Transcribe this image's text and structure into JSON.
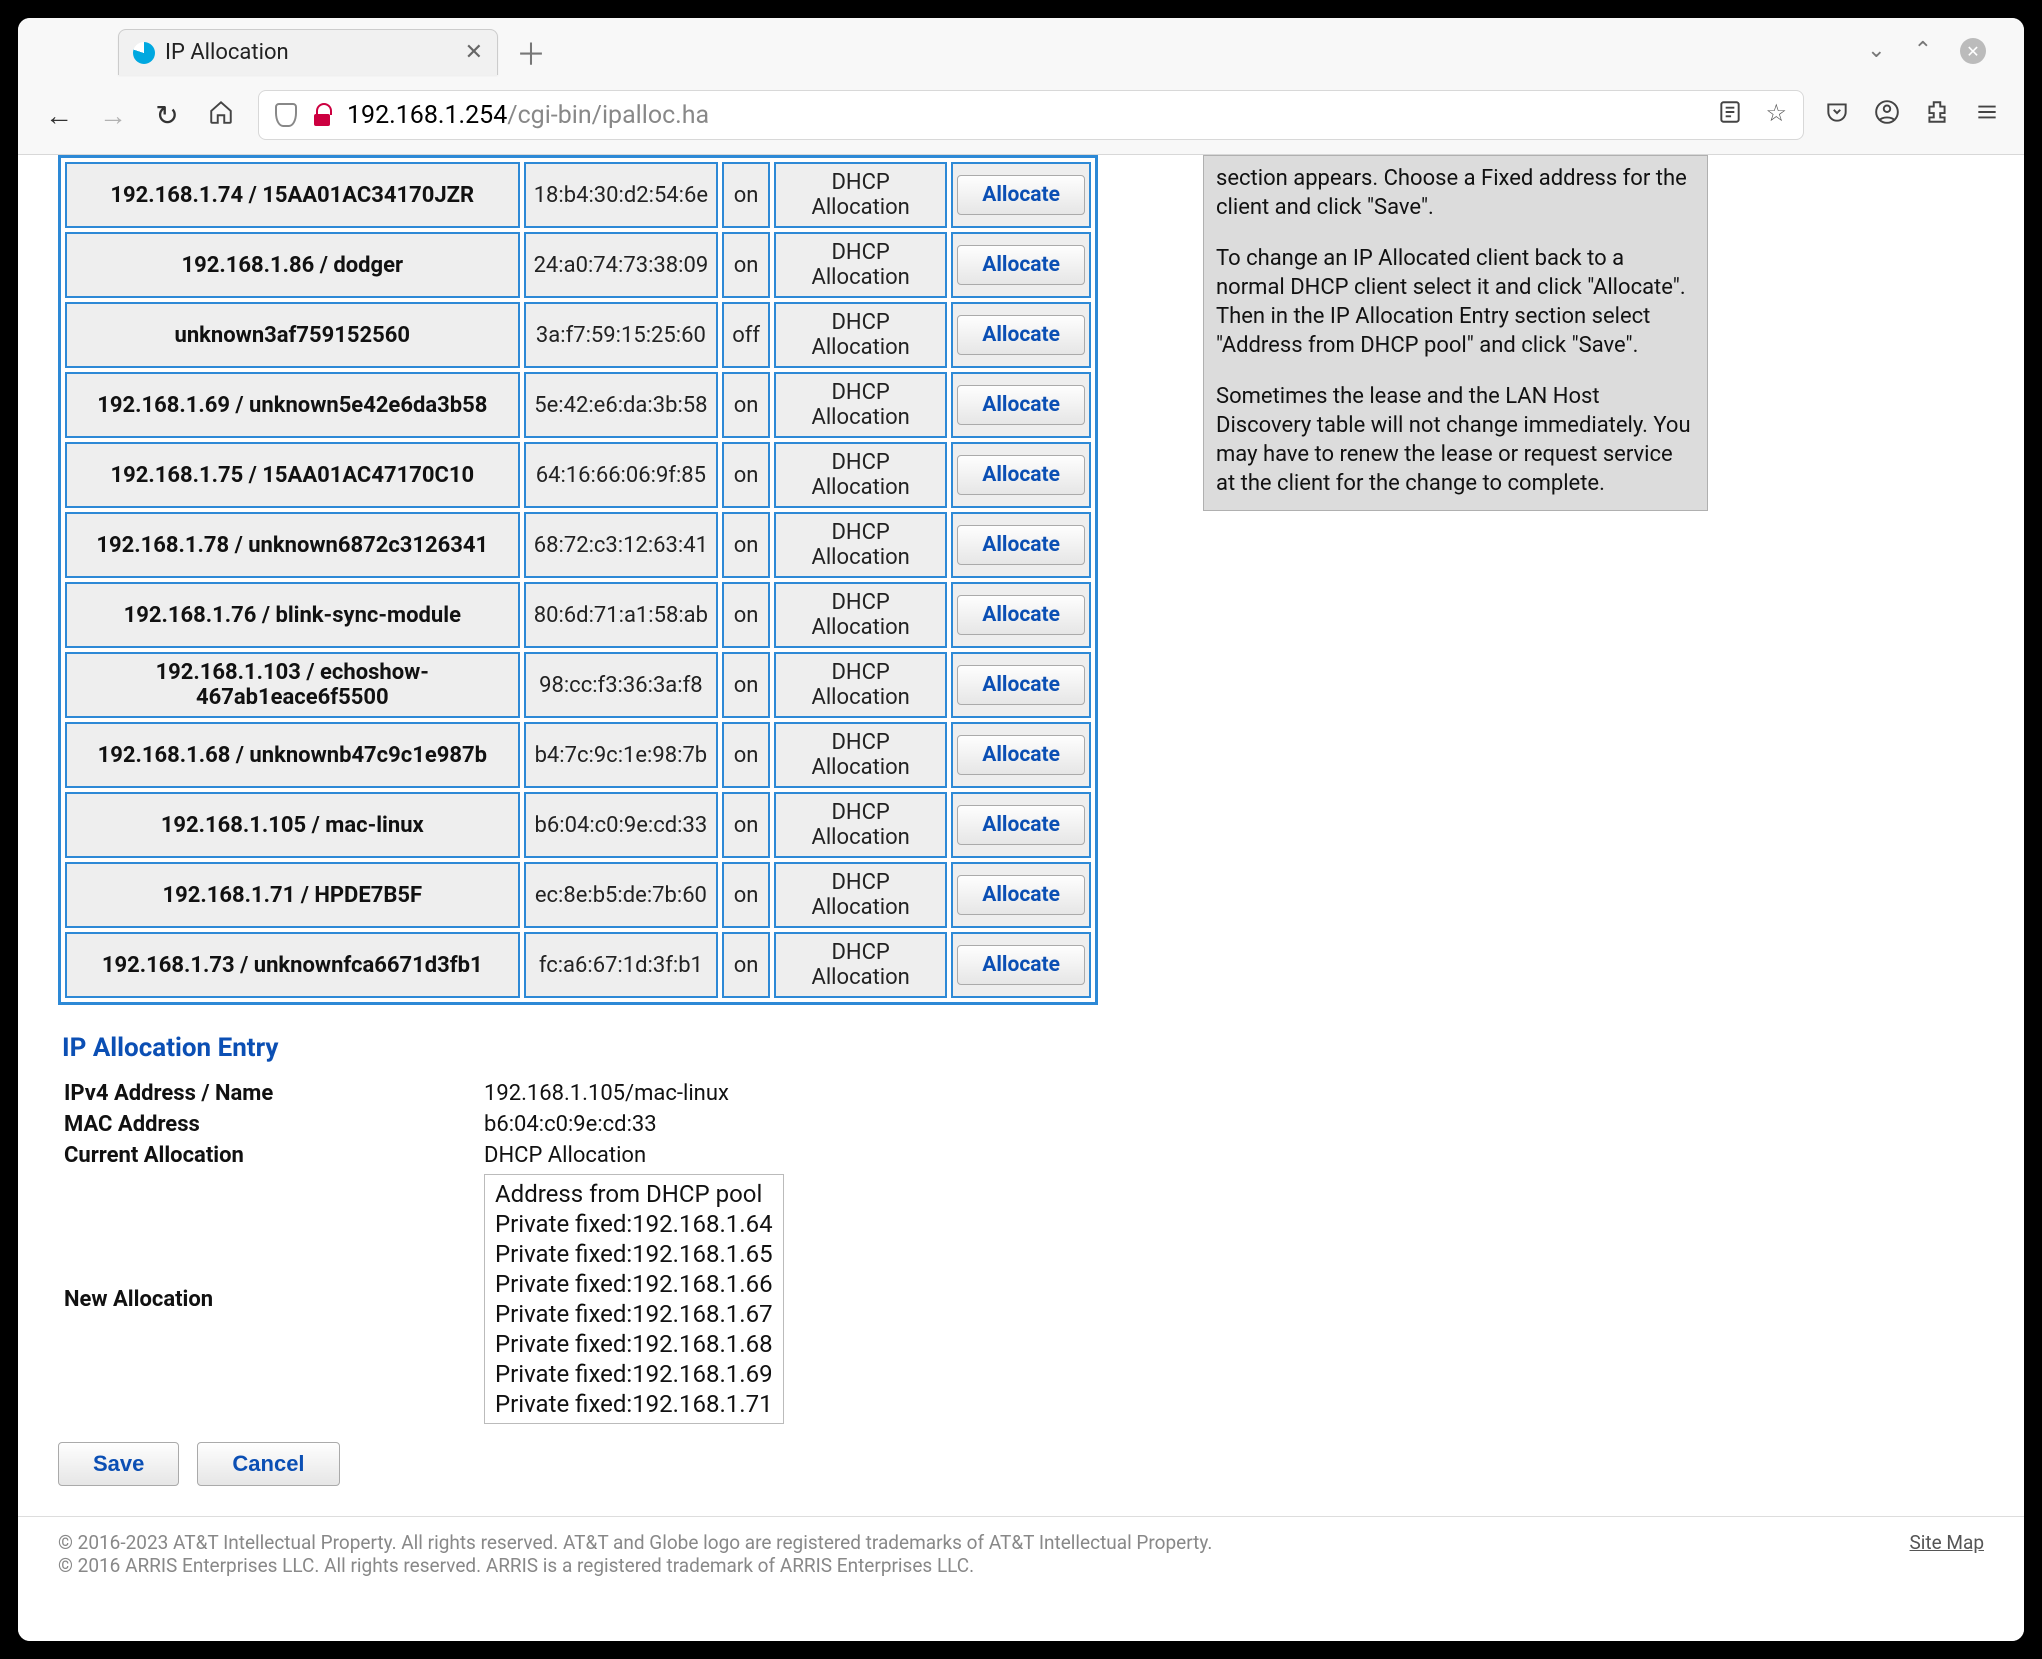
{
  "browser": {
    "tab_title": "IP Allocation",
    "url_host": "192.168.1.254",
    "url_path": "/cgi-bin/ipalloc.ha"
  },
  "table_rows": [
    {
      "name": "192.168.1.74 / 15AA01AC34170JZR",
      "mac": "18:b4:30:d2:54:6e",
      "on": "on",
      "type": "DHCP Allocation",
      "btn": "Allocate"
    },
    {
      "name": "192.168.1.86 / dodger",
      "mac": "24:a0:74:73:38:09",
      "on": "on",
      "type": "DHCP Allocation",
      "btn": "Allocate"
    },
    {
      "name": "unknown3af759152560",
      "mac": "3a:f7:59:15:25:60",
      "on": "off",
      "type": "DHCP Allocation",
      "btn": "Allocate"
    },
    {
      "name": "192.168.1.69 / unknown5e42e6da3b58",
      "mac": "5e:42:e6:da:3b:58",
      "on": "on",
      "type": "DHCP Allocation",
      "btn": "Allocate"
    },
    {
      "name": "192.168.1.75 / 15AA01AC47170C10",
      "mac": "64:16:66:06:9f:85",
      "on": "on",
      "type": "DHCP Allocation",
      "btn": "Allocate"
    },
    {
      "name": "192.168.1.78 / unknown6872c3126341",
      "mac": "68:72:c3:12:63:41",
      "on": "on",
      "type": "DHCP Allocation",
      "btn": "Allocate"
    },
    {
      "name": "192.168.1.76 / blink-sync-module",
      "mac": "80:6d:71:a1:58:ab",
      "on": "on",
      "type": "DHCP Allocation",
      "btn": "Allocate"
    },
    {
      "name": "192.168.1.103 / echoshow-467ab1eace6f5500",
      "mac": "98:cc:f3:36:3a:f8",
      "on": "on",
      "type": "DHCP Allocation",
      "btn": "Allocate"
    },
    {
      "name": "192.168.1.68 / unknownb47c9c1e987b",
      "mac": "b4:7c:9c:1e:98:7b",
      "on": "on",
      "type": "DHCP Allocation",
      "btn": "Allocate"
    },
    {
      "name": "192.168.1.105 / mac-linux",
      "mac": "b6:04:c0:9e:cd:33",
      "on": "on",
      "type": "DHCP Allocation",
      "btn": "Allocate"
    },
    {
      "name": "192.168.1.71 / HPDE7B5F",
      "mac": "ec:8e:b5:de:7b:60",
      "on": "on",
      "type": "DHCP Allocation",
      "btn": "Allocate"
    },
    {
      "name": "192.168.1.73 / unknownfca6671d3fb1",
      "mac": "fc:a6:67:1d:3f:b1",
      "on": "on",
      "type": "DHCP Allocation",
      "btn": "Allocate"
    }
  ],
  "entry": {
    "heading": "IP Allocation Entry",
    "fields": {
      "ipv4_label": "IPv4 Address / Name",
      "ipv4_value": "192.168.1.105/mac-linux",
      "mac_label": "MAC Address",
      "mac_value": "b6:04:c0:9e:cd:33",
      "current_label": "Current Allocation",
      "current_value": "DHCP Allocation",
      "new_label": "New Allocation"
    },
    "options": [
      "Address from DHCP pool",
      "Private fixed:192.168.1.64",
      "Private fixed:192.168.1.65",
      "Private fixed:192.168.1.66",
      "Private fixed:192.168.1.67",
      "Private fixed:192.168.1.68",
      "Private fixed:192.168.1.69",
      "Private fixed:192.168.1.71"
    ],
    "save_label": "Save",
    "cancel_label": "Cancel"
  },
  "help": {
    "p1": "section appears. Choose a Fixed address for the client and click \"Save\".",
    "p2": "To change an IP Allocated client back to a normal DHCP client select it and click \"Allocate\". Then in the IP Allocation Entry section select \"Address from DHCP pool\" and click \"Save\".",
    "p3": "Sometimes the lease and the LAN Host Discovery table will not change immediately. You may have to renew the lease or request service at the client for the change to complete."
  },
  "footer": {
    "line1": "© 2016-2023 AT&T Intellectual Property. All rights reserved. AT&T and Globe logo are registered trademarks of AT&T Intellectual Property.",
    "line2": "© 2016 ARRIS Enterprises LLC. All rights reserved. ARRIS is a registered trademark of ARRIS Enterprises LLC.",
    "sitemap": "Site Map"
  }
}
